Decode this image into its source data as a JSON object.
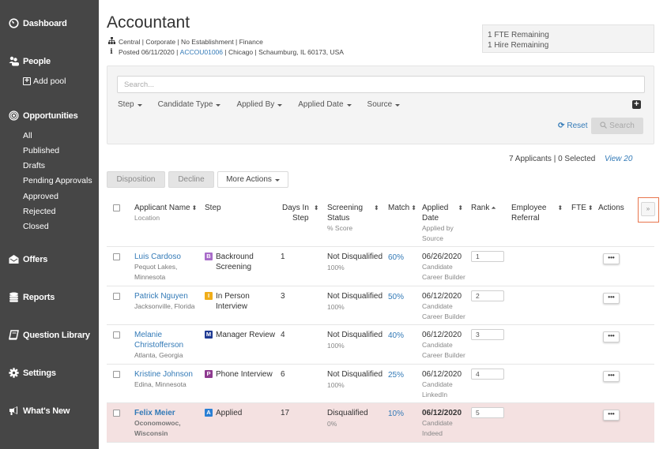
{
  "sidebar": {
    "dashboard": "Dashboard",
    "people": "People",
    "add_pool": "Add pool",
    "opportunities": "Opportunities",
    "opp_items": [
      "All",
      "Published",
      "Drafts",
      "Pending Approvals",
      "Approved",
      "Rejected",
      "Closed"
    ],
    "offers": "Offers",
    "reports": "Reports",
    "question_library": "Question Library",
    "settings": "Settings",
    "whats_new": "What's New"
  },
  "job": {
    "title": "Accountant",
    "org_line": "Central | Corporate | No Establishment | Finance",
    "posted_prefix": "Posted 06/11/2020 | ",
    "req_id": "ACCOU01006",
    "posted_suffix": " | Chicago | Schaumburg, IL 60173, USA"
  },
  "remaining": {
    "fte": "1 FTE Remaining",
    "hire": "1 Hire Remaining"
  },
  "filters": {
    "search_placeholder": "Search...",
    "items": [
      "Step",
      "Candidate Type",
      "Applied By",
      "Applied Date",
      "Source"
    ],
    "reset_label": "Reset",
    "search_label": "Search"
  },
  "summary": {
    "count_text": "7 Applicants | 0 Selected",
    "view_label": "View 20"
  },
  "actions": {
    "disposition": "Disposition",
    "decline": "Decline",
    "more_actions": "More Actions"
  },
  "table": {
    "headers": {
      "applicant_name": "Applicant Name",
      "location": "Location",
      "step": "Step",
      "days_in_step_1": "Days In",
      "days_in_step_2": "Step",
      "screening_1": "Screening",
      "screening_2": "Status",
      "score": "% Score",
      "match": "Match",
      "applied_1": "Applied",
      "applied_2": "Date",
      "applied_by": "Applied by",
      "source": "Source",
      "rank": "Rank",
      "referral_1": "Employee",
      "referral_2": "Referral",
      "fte": "FTE",
      "actions": "Actions"
    },
    "rows": [
      {
        "name": "Luis Cardoso",
        "location": "Pequot Lakes, Minnesota",
        "step_badge": "B",
        "step_color": "#a86bc9",
        "step": "Backround Screening",
        "days": "1",
        "status": "Not Disqualified",
        "score": "100%",
        "match": "60%",
        "date": "06/26/2020",
        "applied_by": "Candidate",
        "source": "Career Builder",
        "rank": "1"
      },
      {
        "name": "Patrick Nguyen",
        "location": "Jacksonville, Florida",
        "step_badge": "I",
        "step_color": "#f0ad1a",
        "step": "In Person Interview",
        "days": "3",
        "status": "Not Disqualified",
        "score": "100%",
        "match": "50%",
        "date": "06/12/2020",
        "applied_by": "Candidate",
        "source": "Career Builder",
        "rank": "2"
      },
      {
        "name": "Melanie Christofferson",
        "location": "Atlanta, Georgia",
        "step_badge": "M",
        "step_color": "#1f3a93",
        "step": "Manager Review",
        "days": "4",
        "status": "Not Disqualified",
        "score": "100%",
        "match": "40%",
        "date": "06/12/2020",
        "applied_by": "Candidate",
        "source": "Career Builder",
        "rank": "3"
      },
      {
        "name": "Kristine Johnson",
        "location": "Edina, Minnesota",
        "step_badge": "P",
        "step_color": "#8e3a8f",
        "step": "Phone Interview",
        "days": "6",
        "status": "Not Disqualified",
        "score": "100%",
        "match": "25%",
        "date": "06/12/2020",
        "applied_by": "Candidate",
        "source": "LinkedIn",
        "rank": "4"
      },
      {
        "name": "Felix Meier",
        "location": "Oconomowoc, Wisconsin",
        "step_badge": "A",
        "step_color": "#2a7fd4",
        "step": "Applied",
        "days": "17",
        "status": "Disqualified",
        "score": "0%",
        "match": "10%",
        "date": "06/12/2020",
        "applied_by": "Candidate",
        "source": "Indeed",
        "rank": "5"
      }
    ]
  },
  "colors": {
    "sidebar_bg": "#464646",
    "link": "#337ab7",
    "disqualified_row": "#f4e1e1",
    "highlight_border": "#e8754d"
  }
}
